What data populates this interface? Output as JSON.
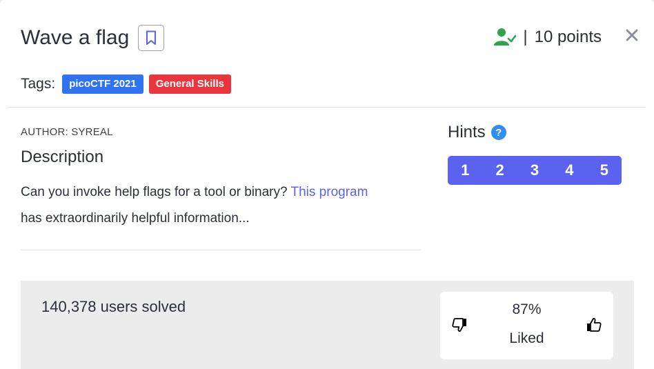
{
  "challenge": {
    "title": "Wave a flag",
    "points_separator": "|",
    "points": "10 points"
  },
  "tags": {
    "label": "Tags:",
    "items": [
      {
        "name": "picoCTF 2021",
        "color": "#2f73f0"
      },
      {
        "name": "General Skills",
        "color": "#e8353e"
      }
    ]
  },
  "details": {
    "author": "AUTHOR: SYREAL",
    "description_title": "Description",
    "description_text_1": "Can you invoke help flags for a tool or binary?",
    "description_link": "This program",
    "description_text_2": "has extraordinarily helpful information..."
  },
  "hints": {
    "title": "Hints",
    "help_glyph": "?",
    "buttons": [
      "1",
      "2",
      "3",
      "4",
      "5"
    ]
  },
  "stats": {
    "solved": "140,378 users solved",
    "liked_percent": "87%",
    "liked_label": "Liked"
  },
  "colors": {
    "accent": "#5b62f0",
    "solved_green": "#2ea44f",
    "help_blue": "#2f8ef0"
  },
  "icons": [
    "bookmark-icon",
    "user-check-icon",
    "close-icon",
    "help-icon",
    "thumbs-down-icon",
    "thumbs-up-icon"
  ]
}
